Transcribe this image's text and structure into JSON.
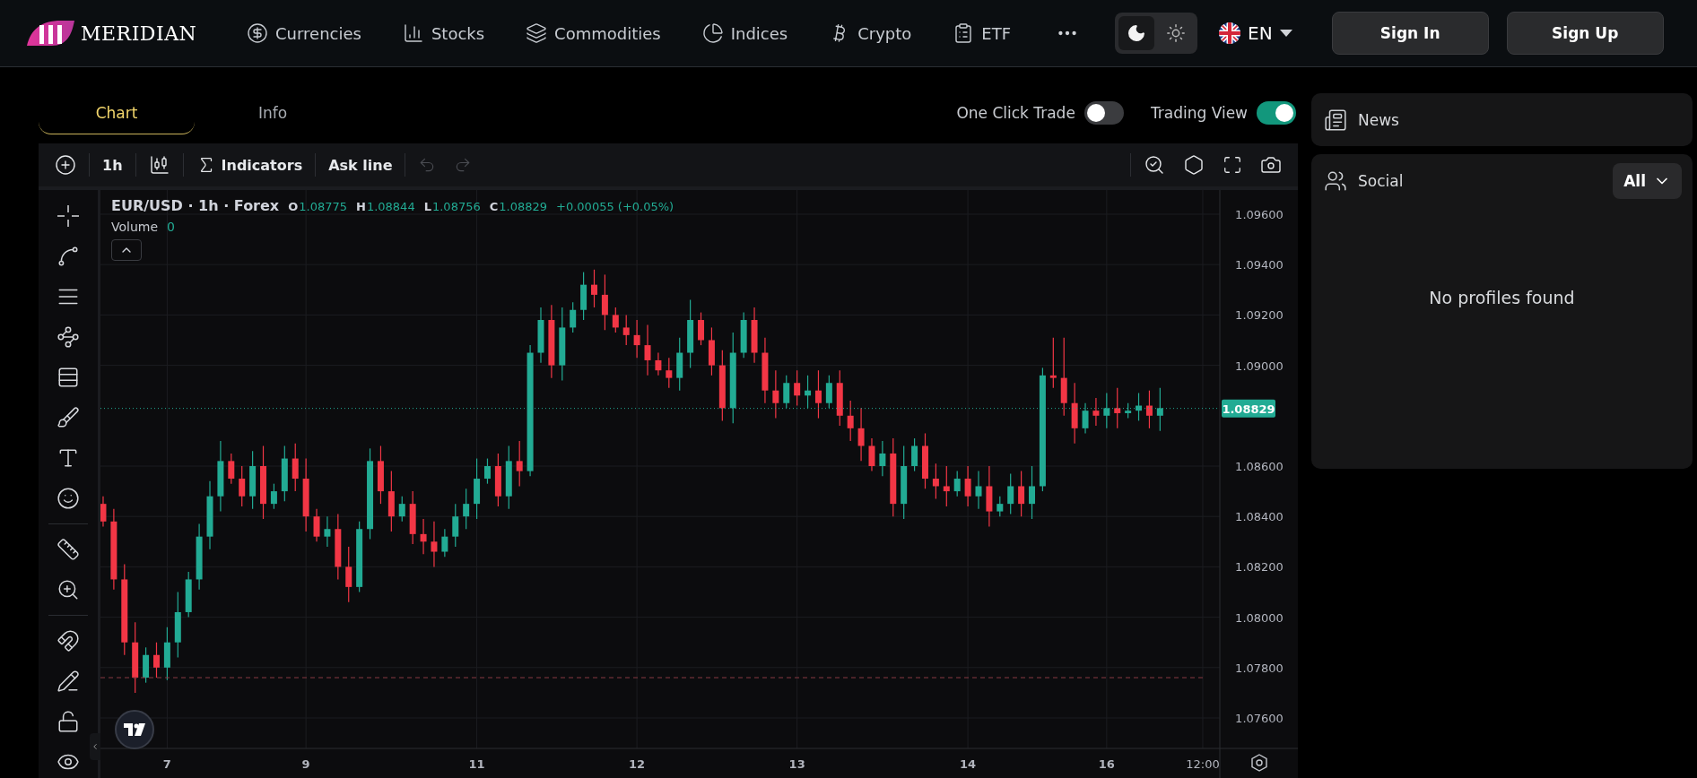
{
  "nav": {
    "brand": "MERIDIAN",
    "items": [
      {
        "label": "Currencies",
        "kind": "currencies"
      },
      {
        "label": "Stocks",
        "kind": "stocks"
      },
      {
        "label": "Commodities",
        "kind": "commodities"
      },
      {
        "label": "Indices",
        "kind": "indices"
      },
      {
        "label": "Crypto",
        "kind": "crypto"
      },
      {
        "label": "ETF",
        "kind": "etf"
      }
    ],
    "theme": [
      {
        "kind": "dark",
        "selected": true
      },
      {
        "kind": "light",
        "selected": false
      }
    ],
    "language": "EN",
    "buttons": [
      "Sign In",
      "Sign Up"
    ]
  },
  "tabs": [
    {
      "label": "Chart",
      "selected": true
    },
    {
      "label": "Info",
      "selected": false
    }
  ],
  "toggles": [
    {
      "label": "One Click Trade",
      "on": false
    },
    {
      "label": "Trading View",
      "on": true
    }
  ],
  "toolbar": {
    "interval": "1h",
    "indicators": "Indicators",
    "ask_line": "Ask line"
  },
  "chart": {
    "symbol": "EUR/USD · 1h · Forex",
    "ohlc": [
      {
        "key": "O",
        "value": "1.08775"
      },
      {
        "key": "H",
        "value": "1.08844"
      },
      {
        "key": "L",
        "value": "1.08756"
      },
      {
        "key": "C",
        "value": "1.08829"
      }
    ],
    "change": "+0.00055 (+0.05%)",
    "volume_label": "Volume",
    "volume": "0",
    "price_label": "1.08829",
    "chart_data": {
      "type": "candlestick",
      "grid": true,
      "ylim": [
        1.07479,
        1.09696
      ],
      "categories": [
        null,
        null,
        null,
        null,
        null,
        null,
        "7",
        null,
        null,
        null,
        null,
        null,
        null,
        null,
        null,
        null,
        null,
        null,
        null,
        "9",
        null,
        null,
        null,
        null,
        null,
        null,
        null,
        null,
        null,
        null,
        null,
        null,
        null,
        null,
        null,
        "11",
        null,
        null,
        null,
        null,
        null,
        null,
        null,
        null,
        null,
        null,
        null,
        null,
        null,
        null,
        "12",
        null,
        null,
        null,
        null,
        null,
        null,
        null,
        null,
        null,
        null,
        null,
        null,
        null,
        null,
        "13",
        null,
        null,
        null,
        null,
        null,
        null,
        null,
        null,
        null,
        null,
        null,
        null,
        null,
        null,
        null,
        "14",
        null,
        null,
        null,
        null,
        null,
        null,
        null,
        null,
        null,
        null,
        null,
        null,
        "16",
        null,
        null,
        null,
        null,
        null,
        null,
        null,
        null,
        "12:00",
        null
      ],
      "yticks": [
        {
          "value": 1.096,
          "label": "1.09600"
        },
        {
          "value": 1.094,
          "label": "1.09400"
        },
        {
          "value": 1.092,
          "label": "1.09200"
        },
        {
          "value": 1.09,
          "label": "1.09000"
        },
        {
          "value": 1.086,
          "label": "1.08600"
        },
        {
          "value": 1.084,
          "label": "1.08400"
        },
        {
          "value": 1.082,
          "label": "1.08200"
        },
        {
          "value": 1.08,
          "label": "1.08000"
        },
        {
          "value": 1.078,
          "label": "1.07800"
        },
        {
          "value": 1.076,
          "label": "1.07600"
        }
      ],
      "ref_lines": [
        {
          "axis": "y",
          "value": 1.08829,
          "color": "#22ab94"
        },
        {
          "axis": "y",
          "value": 1.0776,
          "color": "#8a3a44"
        }
      ],
      "ohlc": [
        [
          1.0845,
          1.0848,
          1.0836,
          1.0838
        ],
        [
          1.0838,
          1.0843,
          1.0811,
          1.0815
        ],
        [
          1.0815,
          1.0821,
          1.0785,
          1.079
        ],
        [
          1.079,
          1.0798,
          1.077,
          1.0776
        ],
        [
          1.0776,
          1.0788,
          1.0774,
          1.0785
        ],
        [
          1.0785,
          1.079,
          1.0776,
          1.078
        ],
        [
          1.078,
          1.0796,
          1.0775,
          1.079
        ],
        [
          1.079,
          1.081,
          1.0784,
          1.0802
        ],
        [
          1.0802,
          1.0818,
          1.08,
          1.0815
        ],
        [
          1.0815,
          1.0837,
          1.0811,
          1.0832
        ],
        [
          1.0832,
          1.0854,
          1.0827,
          1.0848
        ],
        [
          1.0848,
          1.087,
          1.0842,
          1.0862
        ],
        [
          1.0862,
          1.0865,
          1.0853,
          1.0855
        ],
        [
          1.0855,
          1.086,
          1.0844,
          1.0848
        ],
        [
          1.0848,
          1.0866,
          1.0843,
          1.086
        ],
        [
          1.086,
          1.0868,
          1.0839,
          1.0845
        ],
        [
          1.0845,
          1.0853,
          1.0843,
          1.085
        ],
        [
          1.085,
          1.0868,
          1.0846,
          1.0863
        ],
        [
          1.0863,
          1.0869,
          1.085,
          1.0855
        ],
        [
          1.0855,
          1.0863,
          1.0834,
          1.084
        ],
        [
          1.084,
          1.0843,
          1.083,
          1.0832
        ],
        [
          1.0832,
          1.084,
          1.0828,
          1.0835
        ],
        [
          1.0835,
          1.0841,
          1.0815,
          1.082
        ],
        [
          1.082,
          1.0828,
          1.0806,
          1.0812
        ],
        [
          1.0812,
          1.0838,
          1.081,
          1.0835
        ],
        [
          1.0835,
          1.0867,
          1.0831,
          1.0862
        ],
        [
          1.0862,
          1.0868,
          1.0845,
          1.085
        ],
        [
          1.085,
          1.0858,
          1.0834,
          1.084
        ],
        [
          1.084,
          1.0848,
          1.0838,
          1.0845
        ],
        [
          1.0845,
          1.085,
          1.0829,
          1.0833
        ],
        [
          1.0833,
          1.0839,
          1.0825,
          1.083
        ],
        [
          1.083,
          1.0838,
          1.082,
          1.0826
        ],
        [
          1.0826,
          1.0835,
          1.0824,
          1.0832
        ],
        [
          1.0832,
          1.0845,
          1.0828,
          1.084
        ],
        [
          1.084,
          1.0851,
          1.0835,
          1.0845
        ],
        [
          1.0845,
          1.0863,
          1.0839,
          1.0855
        ],
        [
          1.0855,
          1.0863,
          1.0853,
          1.086
        ],
        [
          1.086,
          1.0865,
          1.0844,
          1.0848
        ],
        [
          1.0848,
          1.0868,
          1.0843,
          1.0862
        ],
        [
          1.0862,
          1.087,
          1.0852,
          1.0858
        ],
        [
          1.0858,
          1.0908,
          1.0856,
          1.0905
        ],
        [
          1.0905,
          1.0923,
          1.0901,
          1.0918
        ],
        [
          1.0918,
          1.0924,
          1.0895,
          1.09
        ],
        [
          1.09,
          1.0923,
          1.0894,
          1.0915
        ],
        [
          1.0915,
          1.0925,
          1.0913,
          1.0922
        ],
        [
          1.0922,
          1.0937,
          1.0918,
          1.0932
        ],
        [
          1.0932,
          1.0938,
          1.0923,
          1.0928
        ],
        [
          1.0928,
          1.0936,
          1.0914,
          1.092
        ],
        [
          1.092,
          1.0923,
          1.0913,
          1.0915
        ],
        [
          1.0915,
          1.092,
          1.0908,
          1.0912
        ],
        [
          1.0912,
          1.0918,
          1.0903,
          1.0908
        ],
        [
          1.0908,
          1.0916,
          1.0896,
          1.0902
        ],
        [
          1.0902,
          1.0905,
          1.0896,
          1.0898
        ],
        [
          1.0898,
          1.0903,
          1.0891,
          1.0895
        ],
        [
          1.0895,
          1.0911,
          1.089,
          1.0905
        ],
        [
          1.0905,
          1.0926,
          1.0899,
          1.0918
        ],
        [
          1.0918,
          1.0921,
          1.0908,
          1.091
        ],
        [
          1.091,
          1.0915,
          1.0896,
          1.09
        ],
        [
          1.09,
          1.0906,
          1.0878,
          1.0883
        ],
        [
          1.0883,
          1.0913,
          1.0877,
          1.0905
        ],
        [
          1.0905,
          1.0921,
          1.0903,
          1.0918
        ],
        [
          1.0918,
          1.0923,
          1.0901,
          1.0905
        ],
        [
          1.0905,
          1.0911,
          1.0885,
          1.089
        ],
        [
          1.089,
          1.0898,
          1.0879,
          1.0885
        ],
        [
          1.0885,
          1.0896,
          1.0883,
          1.0893
        ],
        [
          1.0893,
          1.0898,
          1.0884,
          1.0888
        ],
        [
          1.0888,
          1.0896,
          1.0883,
          1.089
        ],
        [
          1.089,
          1.0898,
          1.0879,
          1.0885
        ],
        [
          1.0885,
          1.0896,
          1.0883,
          1.0893
        ],
        [
          1.0893,
          1.0898,
          1.0876,
          1.088
        ],
        [
          1.088,
          1.0886,
          1.087,
          1.0875
        ],
        [
          1.0875,
          1.0883,
          1.0862,
          1.0868
        ],
        [
          1.0868,
          1.0871,
          1.0858,
          1.086
        ],
        [
          1.086,
          1.087,
          1.0856,
          1.0865
        ],
        [
          1.0865,
          1.0871,
          1.084,
          1.0845
        ],
        [
          1.0845,
          1.0868,
          1.0839,
          1.086
        ],
        [
          1.086,
          1.0871,
          1.0858,
          1.0868
        ],
        [
          1.0868,
          1.0873,
          1.0851,
          1.0855
        ],
        [
          1.0855,
          1.0861,
          1.0847,
          1.0852
        ],
        [
          1.0852,
          1.086,
          1.0844,
          1.085
        ],
        [
          1.085,
          1.0858,
          1.0848,
          1.0855
        ],
        [
          1.0855,
          1.086,
          1.0844,
          1.0848
        ],
        [
          1.0848,
          1.0858,
          1.0843,
          1.0852
        ],
        [
          1.0852,
          1.086,
          1.0836,
          1.0842
        ],
        [
          1.0842,
          1.0848,
          1.084,
          1.0845
        ],
        [
          1.0845,
          1.0857,
          1.0841,
          1.0852
        ],
        [
          1.0852,
          1.0858,
          1.084,
          1.0845
        ],
        [
          1.0845,
          1.086,
          1.0839,
          1.0852
        ],
        [
          1.0852,
          1.0899,
          1.085,
          1.0896
        ],
        [
          1.0896,
          1.0911,
          1.0891,
          1.0895
        ],
        [
          1.0895,
          1.0911,
          1.088,
          1.0885
        ],
        [
          1.0885,
          1.0893,
          1.0869,
          1.0875
        ],
        [
          1.0875,
          1.0885,
          1.0873,
          1.0882
        ],
        [
          1.0882,
          1.0887,
          1.0876,
          1.088
        ],
        [
          1.088,
          1.0889,
          1.0875,
          1.0883
        ],
        [
          1.0883,
          1.0891,
          1.0875,
          1.0881
        ],
        [
          1.0881,
          1.0885,
          1.0879,
          1.0882
        ],
        [
          1.0882,
          1.0889,
          1.0878,
          1.0884
        ],
        [
          1.0884,
          1.089,
          1.0875,
          1.088
        ],
        [
          1.088,
          1.0891,
          1.0874,
          1.0883
        ],
        null,
        null,
        null,
        null,
        null
      ]
    }
  },
  "news": {
    "title": "News"
  },
  "social": {
    "title": "Social",
    "filter": "All",
    "empty": "No profiles found"
  }
}
